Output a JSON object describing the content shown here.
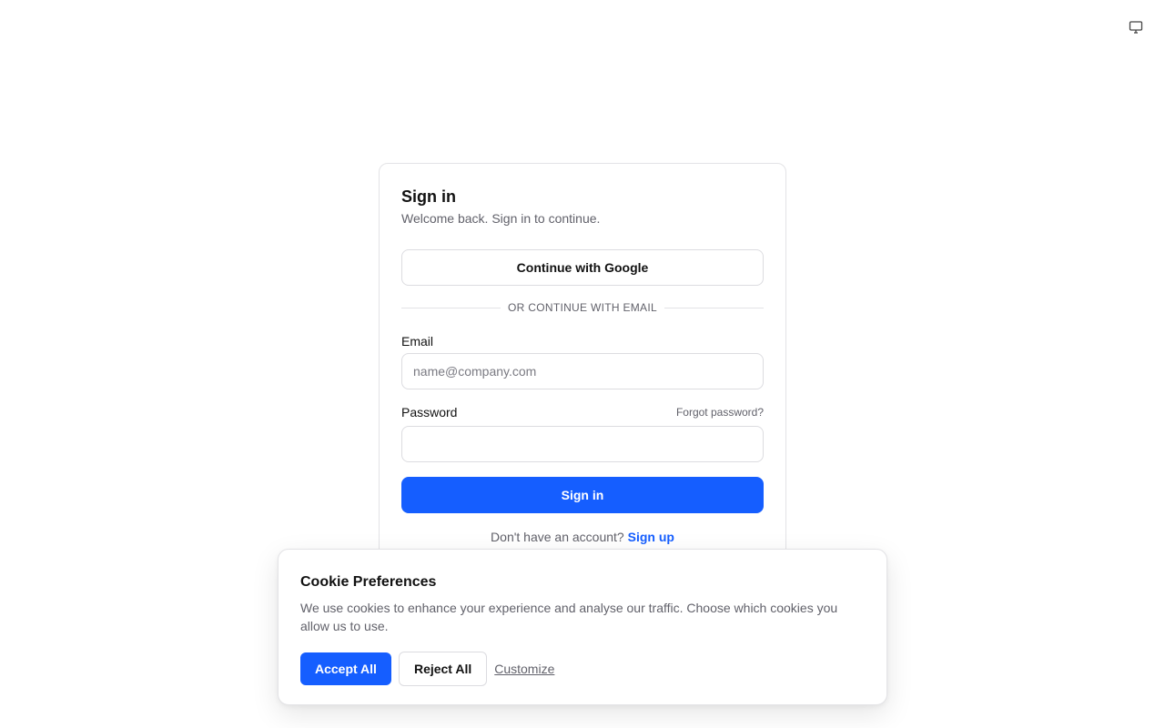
{
  "header": {
    "display_icon": "monitor-icon"
  },
  "signin_card": {
    "title": "Sign in",
    "subtitle": "Welcome back. Sign in to continue.",
    "google_button_label": "Continue with Google",
    "divider_text": "OR CONTINUE WITH EMAIL",
    "email_label": "Email",
    "email_placeholder": "name@company.com",
    "email_value": "",
    "password_label": "Password",
    "forgot_password_label": "Forgot password?",
    "password_value": "",
    "submit_label": "Sign in",
    "signup_prompt": "Don't have an account?",
    "signup_link_label": "Sign up"
  },
  "cookie_banner": {
    "title": "Cookie Preferences",
    "message": "We use cookies to enhance your experience and analyse our traffic. Choose which cookies you allow us to use.",
    "accept_label": "Accept All",
    "reject_label": "Reject All",
    "customize_label": "Customize"
  },
  "colors": {
    "primary": "#155eff",
    "text": "#111111",
    "muted": "#61616a",
    "border": "#e3e3e6"
  }
}
